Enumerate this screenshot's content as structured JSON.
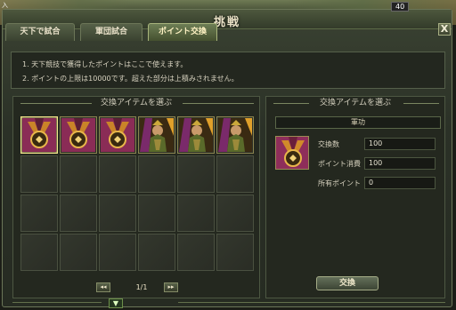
{
  "header": {
    "title": "挑戦",
    "corner_text": "入",
    "level_text": "40",
    "close_label": "X"
  },
  "tabs": [
    {
      "label": "天下で試合",
      "active": false
    },
    {
      "label": "軍団試合",
      "active": false
    },
    {
      "label": "ポイント交換",
      "active": true
    }
  ],
  "info": {
    "line1": "1. 天下競技で獲得したポイントはここで使えます。",
    "line2": "2. ポイントの上限は10000です。超えた部分は上積みされません。"
  },
  "left_panel": {
    "title": "交換アイテムを選ぶ",
    "items": [
      {
        "name": "medal",
        "selected": true
      },
      {
        "name": "medal",
        "selected": false
      },
      {
        "name": "medal",
        "selected": false
      },
      {
        "name": "general",
        "selected": false
      },
      {
        "name": "general",
        "selected": false
      },
      {
        "name": "general",
        "selected": false
      }
    ],
    "pager": {
      "prev_label": "◂◂",
      "next_label": "▸▸",
      "page_text": "1/1"
    },
    "down_label": "▼"
  },
  "right_panel": {
    "title": "交換アイテムを選ぶ",
    "category": "軍功",
    "fields": [
      {
        "label": "交換数",
        "value": "100"
      },
      {
        "label": "ポイント消費",
        "value": "100"
      },
      {
        "label": "所有ポイント",
        "value": "0"
      }
    ],
    "exchange_label": "交換"
  },
  "colors": {
    "accent": "#a8b47c",
    "selected_border": "#f3e48c",
    "panel_bg": "#24281f"
  }
}
